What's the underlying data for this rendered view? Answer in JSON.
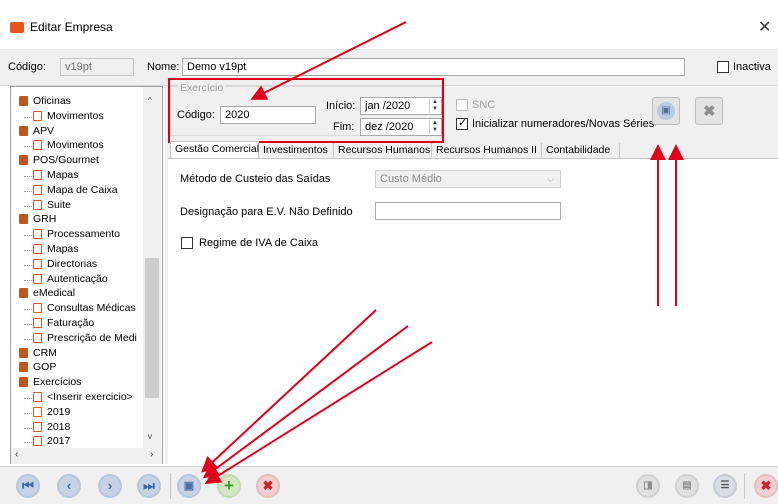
{
  "window": {
    "title": "Editar Empresa"
  },
  "header": {
    "codigo_label": "Código:",
    "codigo_value": "v19pt",
    "nome_label": "Nome:",
    "nome_value": "Demo v19pt",
    "inactiva_label": "Inactiva"
  },
  "tree": {
    "items": [
      {
        "label": "Oficinas",
        "level": 0
      },
      {
        "label": "Movimentos",
        "level": 1
      },
      {
        "label": "APV",
        "level": 0
      },
      {
        "label": "Movimentos",
        "level": 1
      },
      {
        "label": "POS/Gourmet",
        "level": 0
      },
      {
        "label": "Mapas",
        "level": 1
      },
      {
        "label": "Mapa de Caixa",
        "level": 1
      },
      {
        "label": "Suite",
        "level": 1
      },
      {
        "label": "GRH",
        "level": 0
      },
      {
        "label": "Processamento",
        "level": 1
      },
      {
        "label": "Mapas",
        "level": 1
      },
      {
        "label": "Directorias",
        "level": 1
      },
      {
        "label": "Autenticação",
        "level": 1
      },
      {
        "label": "eMedical",
        "level": 0
      },
      {
        "label": "Consultas Médicas",
        "level": 1
      },
      {
        "label": "Faturação",
        "level": 1
      },
      {
        "label": "Prescrição de Medi",
        "level": 1
      },
      {
        "label": "CRM",
        "level": 0
      },
      {
        "label": "GOP",
        "level": 0
      },
      {
        "label": "Exercícios",
        "level": 0
      },
      {
        "label": "<Inserir exercicio>",
        "level": 1
      },
      {
        "label": "2019",
        "level": 1
      },
      {
        "label": "2018",
        "level": 1
      },
      {
        "label": "2017",
        "level": 1
      }
    ]
  },
  "exercicio": {
    "legend": "Exercício",
    "codigo_label": "Código:",
    "codigo_value": "2020",
    "inicio_label": "Início:",
    "inicio_value": "jan /2020",
    "fim_label": "Fim:",
    "fim_value": "dez /2020",
    "snc_label": "SNC",
    "init_label": "Inicializar numeradores/Novas Séries"
  },
  "tabs": [
    {
      "label": "Gestão Comercial"
    },
    {
      "label": "Investimentos"
    },
    {
      "label": "Recursos Humanos"
    },
    {
      "label": "Recursos Humanos II"
    },
    {
      "label": "Contabilidade"
    }
  ],
  "form": {
    "metodo_label": "Método de Custeio das Saídas",
    "metodo_value": "Custo Médio",
    "designacao_label": "Designação para E.V. Não Definido",
    "designacao_value": "",
    "regime_label": "Regime de IVA de Caixa"
  },
  "colors": {
    "annotation_red": "#e0001a",
    "accent_orange": "#e8541e"
  }
}
